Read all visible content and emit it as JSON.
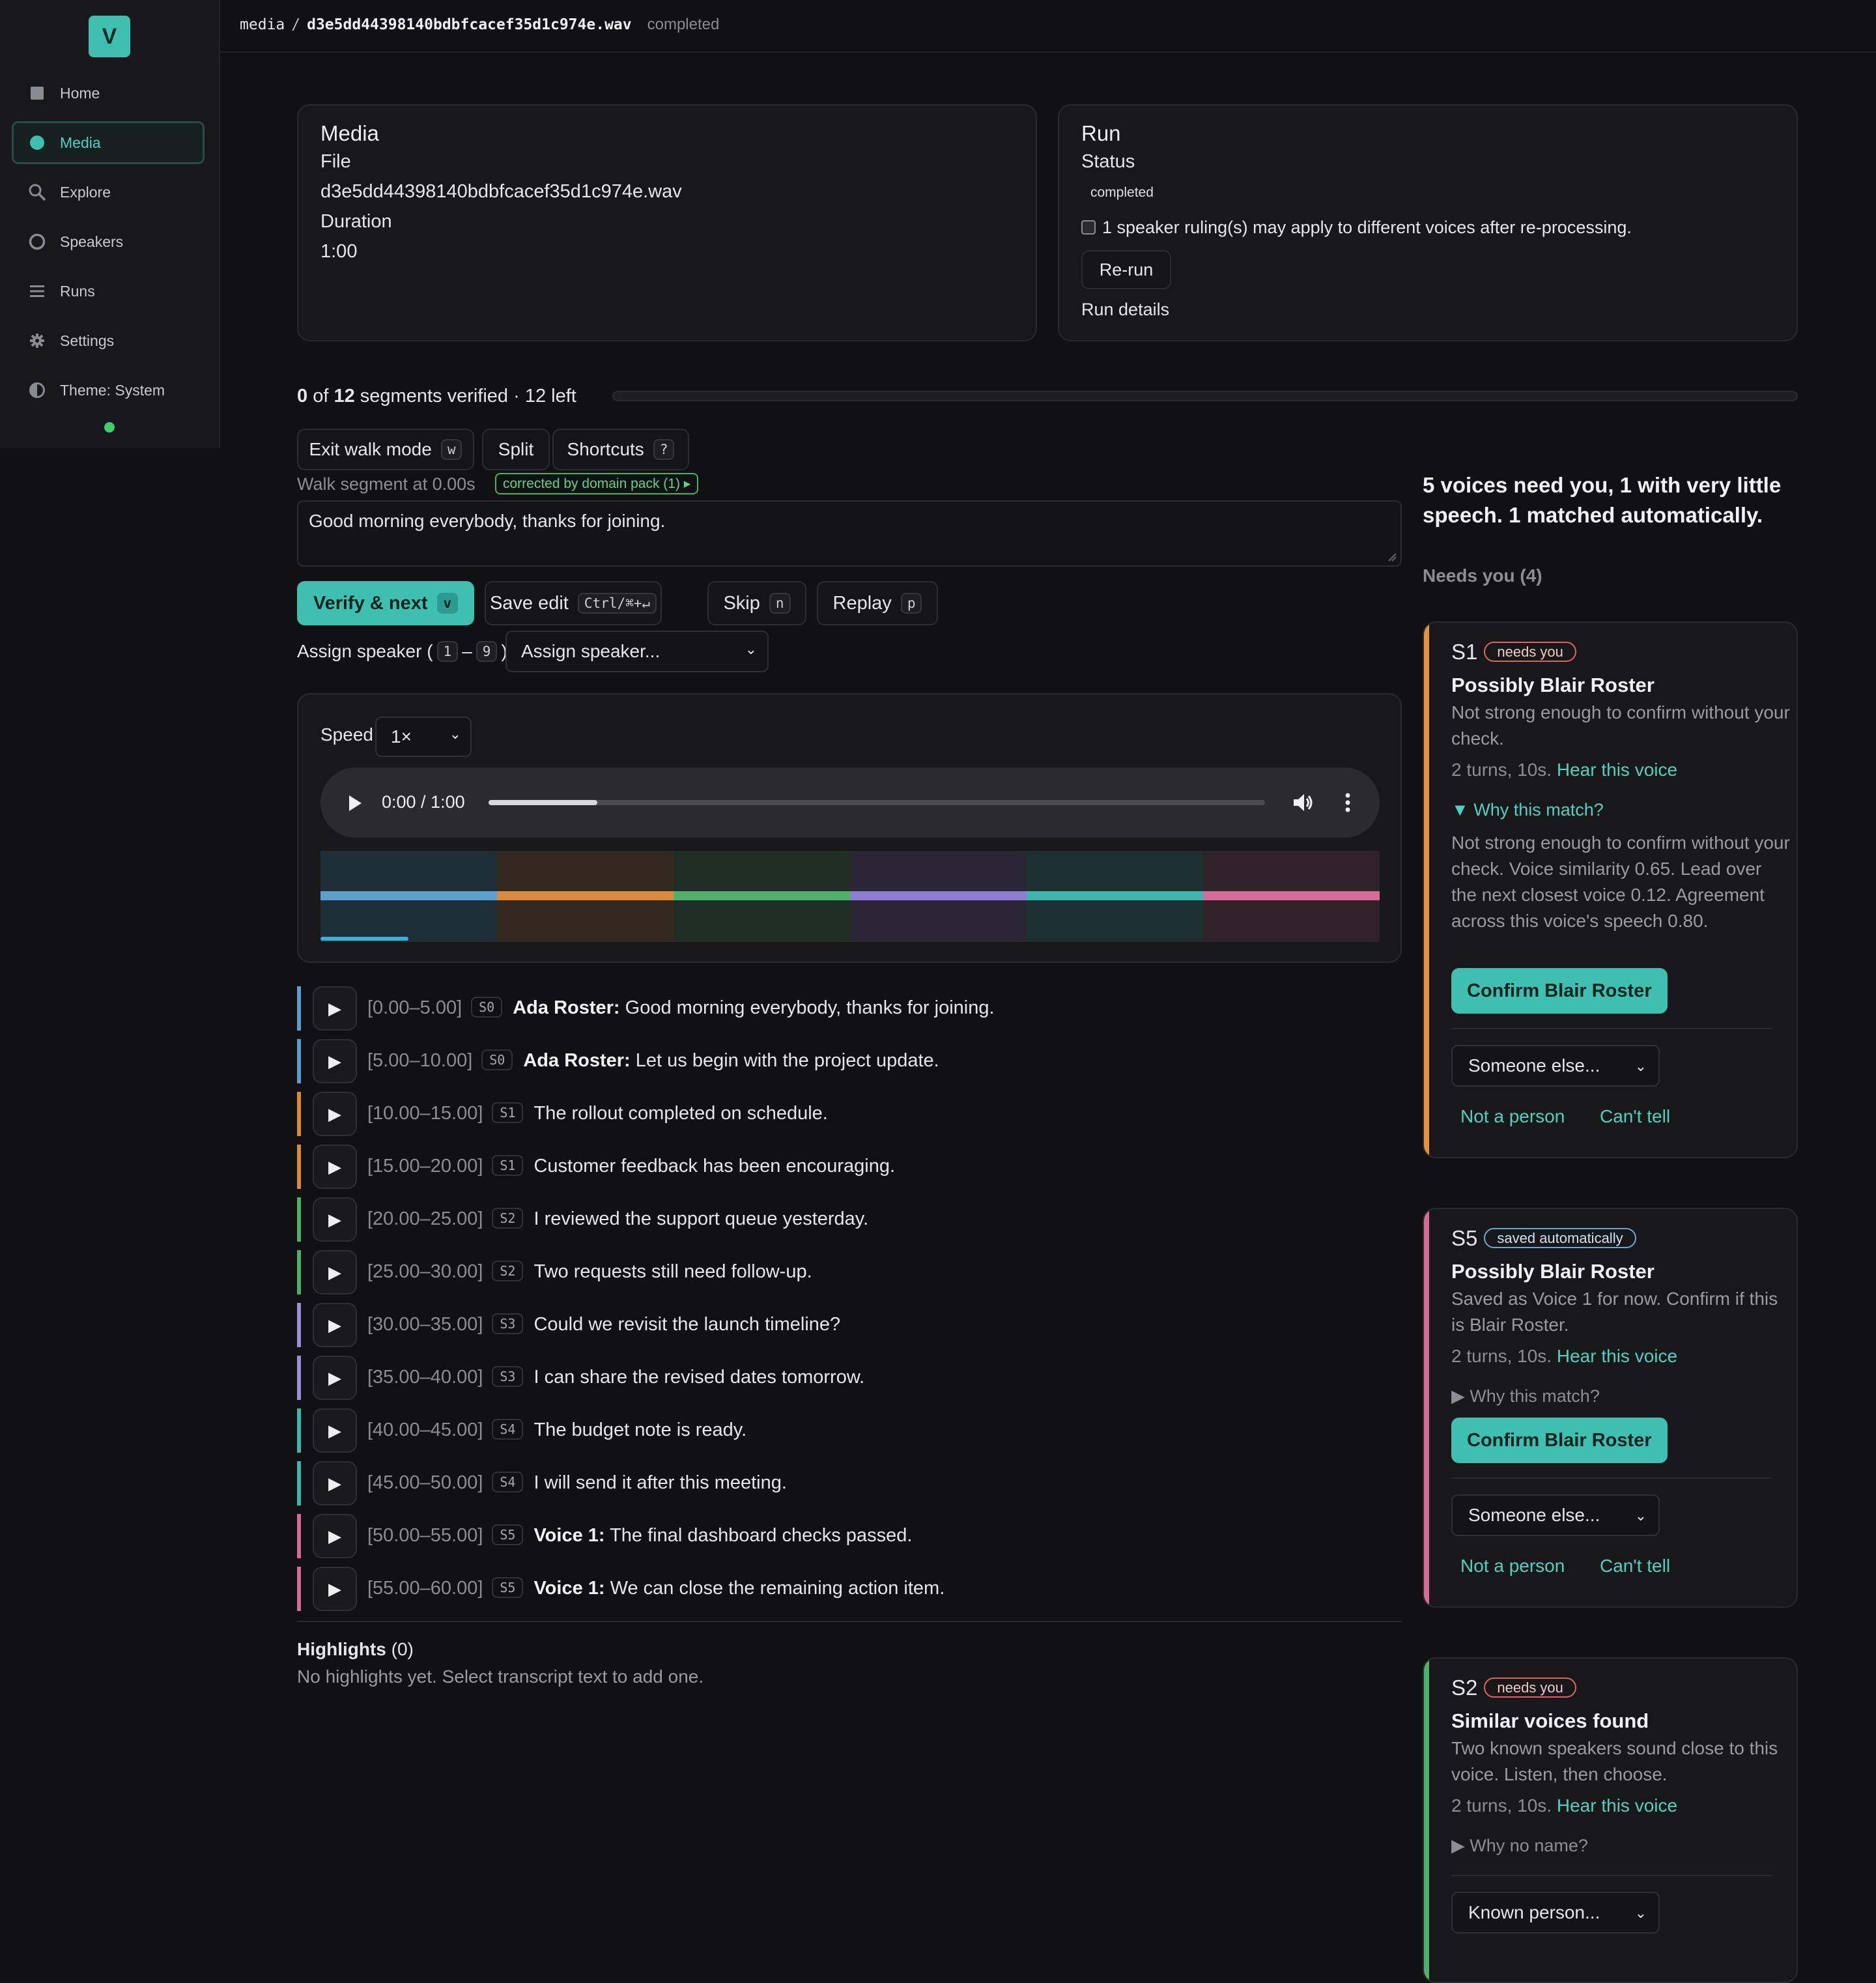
{
  "sidebar": {
    "logo": "V",
    "items": [
      {
        "label": "Home"
      },
      {
        "label": "Media"
      },
      {
        "label": "Explore"
      },
      {
        "label": "Speakers"
      },
      {
        "label": "Runs"
      },
      {
        "label": "Settings"
      },
      {
        "label": "Theme: System"
      }
    ]
  },
  "header": {
    "crumb_root": "media",
    "crumb_sep": "/",
    "crumb_file": "d3e5dd44398140bdbfcacef35d1c974e.wav",
    "status": "completed"
  },
  "media_card": {
    "title": "Media",
    "file_label": "File",
    "file_value": "d3e5dd44398140bdbfcacef35d1c974e.wav",
    "duration_label": "Duration",
    "duration_value": "1:00"
  },
  "run_card": {
    "title": "Run",
    "status_label": "Status",
    "status_value": "completed",
    "ruling_text": "1 speaker ruling(s) may apply to different voices after re-processing.",
    "rerun_label": "Re-run",
    "details_link": "Run details"
  },
  "verify": {
    "verified": "0",
    "of": "of",
    "total": "12",
    "suffix": "segments verified · 12 left",
    "progress": 0
  },
  "walk": {
    "exit_label": "Exit walk mode",
    "exit_key": "w",
    "split_label": "Split",
    "shortcuts_label": "Shortcuts",
    "shortcuts_key": "?",
    "segment_label": "Walk segment at 0.00s",
    "corrected_badge": "corrected by domain pack (1) ▸",
    "text": "Good morning everybody, thanks for joining.",
    "verify_label": "Verify & next",
    "verify_key": "v",
    "save_label": "Save edit",
    "save_key": "Ctrl/⌘+↵",
    "skip_label": "Skip",
    "skip_key": "n",
    "replay_label": "Replay",
    "replay_key": "p",
    "assign_prefix": "Assign speaker (",
    "assign_k1": "1",
    "assign_dash": "–",
    "assign_k2": "9",
    "assign_suffix": "):",
    "assign_select": "Assign speaker..."
  },
  "player": {
    "speed_label": "Speed",
    "speed_value": "1×",
    "time": "0:00 / 1:00",
    "played_fraction": 0.14,
    "timeline_colors": [
      "#5a9fce",
      "#d98a3d",
      "#4fb06a",
      "#8c7fd0",
      "#3eb5ad",
      "#d36d98"
    ],
    "timeline_bg": [
      "#1f2f38",
      "#33291f",
      "#1f2f25",
      "#2a2636",
      "#1c3032",
      "#31222a"
    ],
    "timeline_progress": 0.083
  },
  "segments": [
    {
      "range": "[0.00–5.00]",
      "code": "S0",
      "speaker": "Ada Roster:",
      "text": "Good morning everybody, thanks for joining.",
      "color": "#5a9fce"
    },
    {
      "range": "[5.00–10.00]",
      "code": "S0",
      "speaker": "Ada Roster:",
      "text": "Let us begin with the project update.",
      "color": "#5a9fce"
    },
    {
      "range": "[10.00–15.00]",
      "code": "S1",
      "speaker": "",
      "text": "The rollout completed on schedule.",
      "color": "#d98a3d"
    },
    {
      "range": "[15.00–20.00]",
      "code": "S1",
      "speaker": "",
      "text": "Customer feedback has been encouraging.",
      "color": "#d98a3d"
    },
    {
      "range": "[20.00–25.00]",
      "code": "S2",
      "speaker": "",
      "text": "I reviewed the support queue yesterday.",
      "color": "#4fb06a"
    },
    {
      "range": "[25.00–30.00]",
      "code": "S2",
      "speaker": "",
      "text": "Two requests still need follow-up.",
      "color": "#4fb06a"
    },
    {
      "range": "[30.00–35.00]",
      "code": "S3",
      "speaker": "",
      "text": "Could we revisit the launch timeline?",
      "color": "#9a8fd6"
    },
    {
      "range": "[35.00–40.00]",
      "code": "S3",
      "speaker": "",
      "text": "I can share the revised dates tomorrow.",
      "color": "#9a8fd6"
    },
    {
      "range": "[40.00–45.00]",
      "code": "S4",
      "speaker": "",
      "text": "The budget note is ready.",
      "color": "#3eb5ad"
    },
    {
      "range": "[45.00–50.00]",
      "code": "S4",
      "speaker": "",
      "text": "I will send it after this meeting.",
      "color": "#3eb5ad"
    },
    {
      "range": "[50.00–55.00]",
      "code": "S5",
      "speaker": "Voice 1:",
      "text": "The final dashboard checks passed.",
      "color": "#d36d98"
    },
    {
      "range": "[55.00–60.00]",
      "code": "S5",
      "speaker": "Voice 1:",
      "text": "We can close the remaining action item.",
      "color": "#d36d98"
    }
  ],
  "highlights": {
    "title": "Highlights",
    "count": "(0)",
    "empty": "No highlights yet. Select transcript text to add one."
  },
  "voices": {
    "summary": "5 voices need you, 1 with very little speech. 1 matched automatically.",
    "needs_heading": "Needs you (4)",
    "cards": [
      {
        "id": "S1",
        "badge": "needs you",
        "title": "Possibly Blair Roster",
        "desc": "Not strong enough to confirm without your check.",
        "turns": "2 turns, 10s.",
        "hear": "Hear this voice",
        "why": "Why this match?",
        "why_text": "Not strong enough to confirm without your check. Voice similarity 0.65. Lead over the next closest voice 0.12. Agreement across this voice's speech 0.80.",
        "confirm": "Confirm Blair Roster",
        "select": "Someone else...",
        "not_person": "Not a person",
        "cant_tell": "Can't tell",
        "accent": "#e0953d"
      },
      {
        "id": "S5",
        "badge": "saved automatically",
        "title": "Possibly Blair Roster",
        "desc": "Saved as Voice 1 for now. Confirm if this is Blair Roster.",
        "turns": "2 turns, 10s.",
        "hear": "Hear this voice",
        "why": "Why this match?",
        "confirm": "Confirm Blair Roster",
        "select": "Someone else...",
        "not_person": "Not a person",
        "cant_tell": "Can't tell",
        "accent": "#d36d98"
      },
      {
        "id": "S2",
        "badge": "needs you",
        "title": "Similar voices found",
        "desc": "Two known speakers sound close to this voice. Listen, then choose.",
        "turns": "2 turns, 10s.",
        "hear": "Hear this voice",
        "why": "Why no name?",
        "select": "Known person...",
        "accent": "#4fb06a"
      }
    ]
  }
}
